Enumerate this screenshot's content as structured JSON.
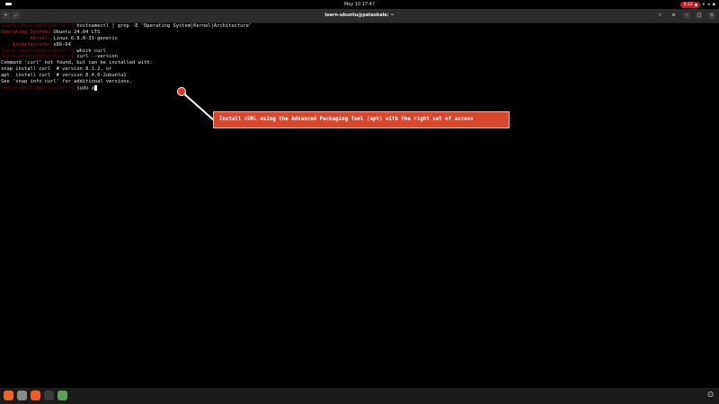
{
  "topbar": {
    "clock": "May 10 17:47",
    "record_badge": "0:33",
    "icons": [
      "wifi-icon",
      "volume-icon",
      "power-icon"
    ]
  },
  "terminal": {
    "title": "learn-ubuntu@pataskale: ~",
    "lines": [
      {
        "prompt": "learn-ubuntu@pataskale:~$",
        "text": " hostnamectl | grep -E 'Operating System|Kernel|Architecture'"
      },
      {
        "key": "Operating System:",
        "text": " Ubuntu 24.04 LTS"
      },
      {
        "key": "          Kernel:",
        "text": " Linux 6.8.0-31-generic"
      },
      {
        "key": "    Architecture:",
        "text": " x86-64"
      },
      {
        "prompt": "learn-ubuntu@pataskale:~$",
        "text": " which curl"
      },
      {
        "prompt": "learn-ubuntu@pataskale:~$",
        "text": " curl --version"
      },
      {
        "text": "Command 'curl' not found, but can be installed with:"
      },
      {
        "text": "snap install curl  # version 8.1.2, or"
      },
      {
        "text": "apt  install curl  # version 8.4.0-2ubuntu1"
      },
      {
        "text": "See 'snap info curl' for additional versions."
      },
      {
        "prompt": "learn-ubuntu@pataskale:~$",
        "text": " sudo a"
      }
    ]
  },
  "annotation": {
    "text": "Install cURL using the Advanced Packaging Tool (apt) with the right set of access"
  },
  "colors": {
    "prompt": "#7a0f0f",
    "key": "#e01b24",
    "annotation": "#d9462e"
  },
  "dock": {
    "apps": [
      {
        "name": "firefox-icon",
        "color": "#e8662b"
      },
      {
        "name": "files-icon",
        "color": "#8a8a8a"
      },
      {
        "name": "software-center-icon",
        "color": "#e85d2a"
      },
      {
        "name": "terminal-icon",
        "color": "#3a3a3a"
      },
      {
        "name": "text-editor-icon",
        "color": "#5aa05a"
      }
    ]
  }
}
